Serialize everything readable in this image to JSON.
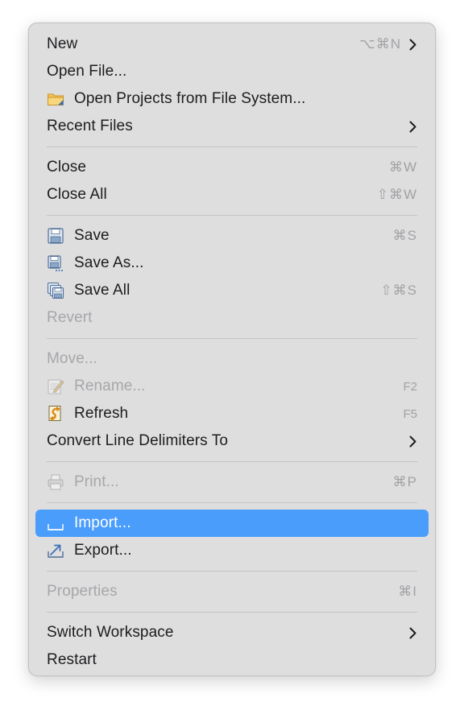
{
  "menu": {
    "items": {
      "new": {
        "label": "New",
        "shortcut": "⌥⌘N"
      },
      "open_file": {
        "label": "Open File..."
      },
      "open_projects": {
        "label": "Open Projects from File System..."
      },
      "recent_files": {
        "label": "Recent Files"
      },
      "close": {
        "label": "Close",
        "shortcut": "⌘W"
      },
      "close_all": {
        "label": "Close All",
        "shortcut": "⇧⌘W"
      },
      "save": {
        "label": "Save",
        "shortcut": "⌘S"
      },
      "save_as": {
        "label": "Save As..."
      },
      "save_all": {
        "label": "Save All",
        "shortcut": "⇧⌘S"
      },
      "revert": {
        "label": "Revert"
      },
      "move": {
        "label": "Move..."
      },
      "rename": {
        "label": "Rename...",
        "shortcut": "F2"
      },
      "refresh": {
        "label": "Refresh",
        "shortcut": "F5"
      },
      "convert_line_delimiters": {
        "label": "Convert Line Delimiters To"
      },
      "print": {
        "label": "Print...",
        "shortcut": "⌘P"
      },
      "import": {
        "label": "Import..."
      },
      "export": {
        "label": "Export..."
      },
      "properties": {
        "label": "Properties",
        "shortcut": "⌘I"
      },
      "switch_workspace": {
        "label": "Switch Workspace"
      },
      "restart": {
        "label": "Restart"
      }
    },
    "icons": {
      "open_projects": "folder-icon",
      "save": "save-icon",
      "save_as": "save-as-icon",
      "save_all": "save-all-icon",
      "rename": "rename-icon",
      "refresh": "refresh-icon",
      "print": "printer-icon",
      "import": "import-icon",
      "export": "export-icon",
      "submenu": "chevron-right-icon"
    },
    "colors": {
      "background": "#dededf",
      "highlight": "#4a9dfb",
      "text": "#1d1d1f",
      "disabled_text": "#a7a7aa",
      "shortcut_text": "#a2a2a5"
    }
  }
}
